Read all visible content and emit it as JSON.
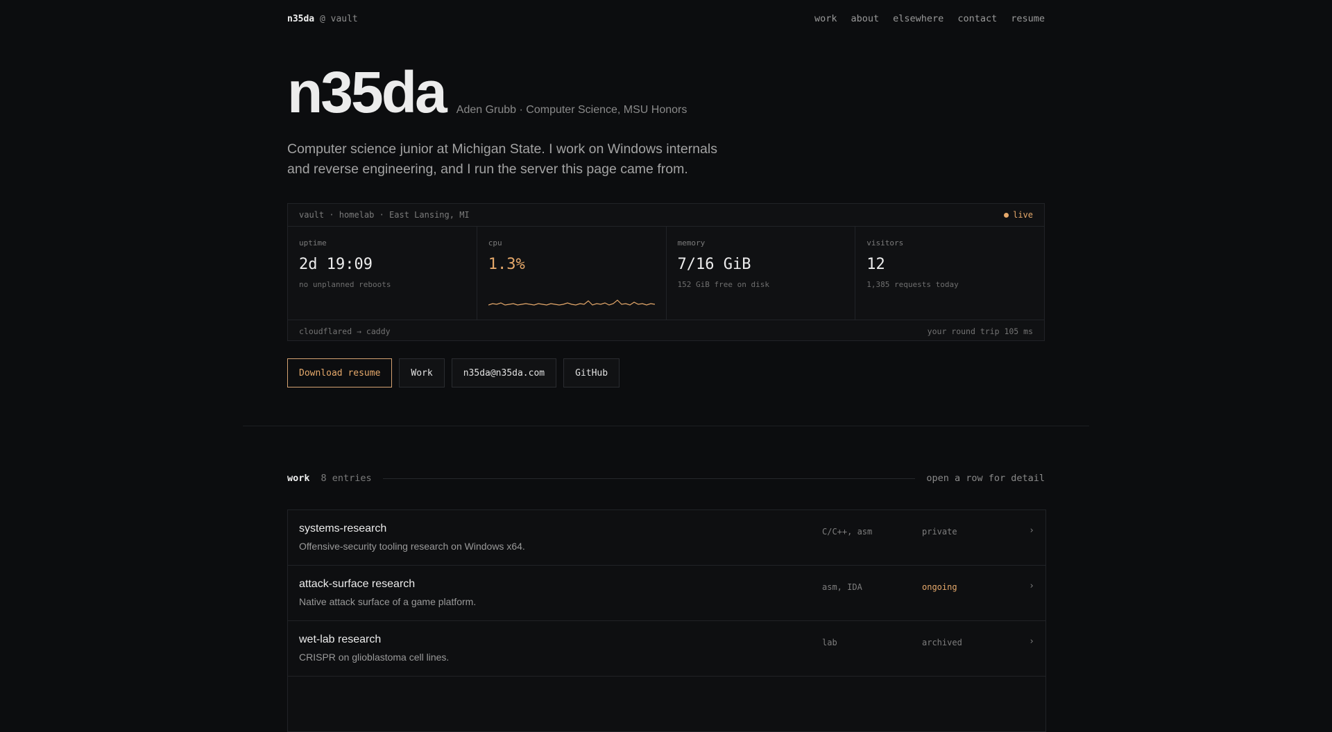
{
  "nav": {
    "brand_name": "n35da",
    "brand_host": "@ vault",
    "links": [
      "work",
      "about",
      "elsewhere",
      "contact",
      "resume"
    ]
  },
  "hero": {
    "title": "n35da",
    "subtitle": "Aden Grubb · Computer Science, MSU Honors",
    "description": "Computer science junior at Michigan State. I work on Windows internals and reverse engineering, and I run the server this page came from."
  },
  "panel": {
    "header": "vault · homelab · East Lansing, MI",
    "status": "live",
    "stats": [
      {
        "label": "uptime",
        "value": "2d 19:09",
        "note": "no unplanned reboots"
      },
      {
        "label": "cpu",
        "value": "1.3%",
        "note": ""
      },
      {
        "label": "memory",
        "value": "7/16 GiB",
        "note": "152 GiB free on disk"
      },
      {
        "label": "visitors",
        "value": "12",
        "note": "1,385 requests today"
      }
    ],
    "footer_left": "cloudflared → caddy",
    "footer_right": "your round trip 105 ms"
  },
  "buttons": {
    "resume": "Download resume",
    "work": "Work",
    "email": "n35da@n35da.com",
    "github": "GitHub"
  },
  "work": {
    "title": "work",
    "count": "8 entries",
    "hint": "open a row for detail",
    "rows": [
      {
        "name": "systems-research",
        "desc": "Offensive-security tooling research on Windows x64.",
        "tech": "C/C++, asm",
        "status": "private"
      },
      {
        "name": "attack-surface research",
        "desc": "Native attack surface of a game platform.",
        "tech": "asm, IDA",
        "status": "ongoing"
      },
      {
        "name": "wet-lab research",
        "desc": "CRISPR on glioblastoma cell lines.",
        "tech": "lab",
        "status": "archived"
      }
    ],
    "chevron": "›"
  },
  "colors": {
    "background": "#0c0d0f",
    "accent": "#e6a96b",
    "border": "#212327"
  },
  "icons": {
    "live_indicator": "dot-icon",
    "row_chevron": "chevron-right-icon"
  }
}
